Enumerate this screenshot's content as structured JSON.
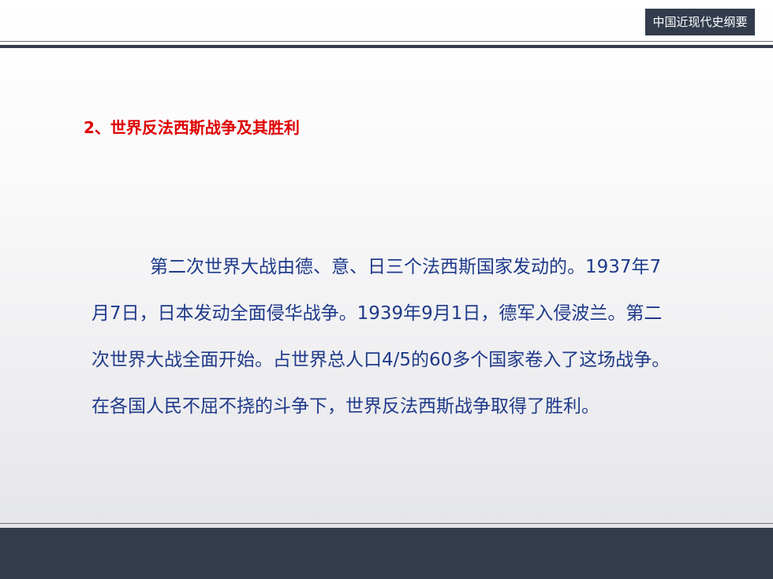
{
  "header": {
    "badge": "中国近现代史纲要"
  },
  "content": {
    "section_title": "2、世界反法西斯战争及其胜利",
    "paragraph_lines": [
      "第二次世界大战由德、意、日三个法西斯国家发动的。1937年7",
      "月7日，日本发动全面侵华战争。1939年9月1日，德军入侵波兰。第二",
      "次世界大战全面开始。占世界总人口4/5的60多个国家卷入了这场战争。",
      "在各国人民不屈不挠的斗争下，世界反法西斯战争取得了胜利。"
    ]
  },
  "colors": {
    "title_red": "#e00000",
    "body_blue": "#1f3a8a",
    "bar_dark": "#323c4c"
  }
}
